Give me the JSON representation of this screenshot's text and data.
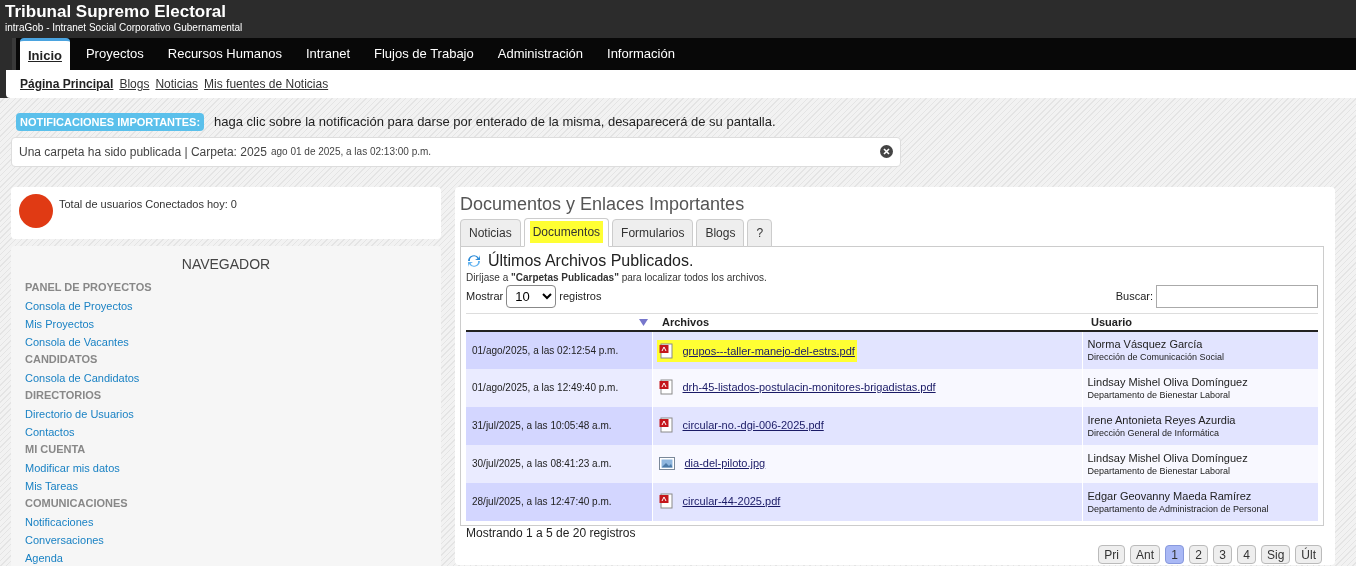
{
  "header": {
    "title": "Tribunal Supremo Electoral",
    "subtitle": "intraGob - Intranet Social Corporativo Gubernamental"
  },
  "nav": [
    {
      "label": "Inicio",
      "selected": true
    },
    {
      "label": "Proyectos",
      "selected": false
    },
    {
      "label": "Recursos Humanos",
      "selected": false
    },
    {
      "label": "Intranet",
      "selected": false
    },
    {
      "label": "Flujos de Trabajo",
      "selected": false
    },
    {
      "label": "Administración",
      "selected": false
    },
    {
      "label": "Información",
      "selected": false
    }
  ],
  "subnav": [
    {
      "label": "Página Principal",
      "selected": true
    },
    {
      "label": "Blogs",
      "selected": false
    },
    {
      "label": "Noticias",
      "selected": false
    },
    {
      "label": "Mis fuentes de Noticias",
      "selected": false
    }
  ],
  "notifications": {
    "badge": "NOTIFICACIONES IMPORTANTES:",
    "hint": "haga clic sobre la notificación para darse por enterado de la misma, desaparecerá de su pantalla.",
    "items": [
      {
        "text": "Una carpeta ha sido publicada | Carpeta: 2025",
        "time": "ago 01 de 2025, a las 02:13:00 p.m."
      }
    ]
  },
  "online": {
    "text": "Total de usuarios Conectados hoy: 0"
  },
  "navigator": {
    "title": "NAVEGADOR",
    "items": [
      {
        "kind": "heading",
        "label": "PANEL DE PROYECTOS"
      },
      {
        "kind": "link",
        "label": "Consola de Proyectos"
      },
      {
        "kind": "link",
        "label": "Mis Proyectos"
      },
      {
        "kind": "link",
        "label": "Consola de Vacantes"
      },
      {
        "kind": "heading",
        "label": "CANDIDATOS"
      },
      {
        "kind": "link",
        "label": "Consola de Candidatos"
      },
      {
        "kind": "heading",
        "label": "DIRECTORIOS"
      },
      {
        "kind": "link",
        "label": "Directorio de Usuarios"
      },
      {
        "kind": "link",
        "label": "Contactos"
      },
      {
        "kind": "heading",
        "label": "MI CUENTA"
      },
      {
        "kind": "link",
        "label": "Modificar mis datos"
      },
      {
        "kind": "link",
        "label": "Mis Tareas"
      },
      {
        "kind": "heading",
        "label": "COMUNICACIONES"
      },
      {
        "kind": "link",
        "label": "Notificaciones"
      },
      {
        "kind": "link",
        "label": "Conversaciones"
      },
      {
        "kind": "link",
        "label": "Agenda"
      }
    ]
  },
  "documents": {
    "title": "Documentos y Enlaces Importantes",
    "tabs": [
      {
        "label": "Noticias",
        "selected": false,
        "highlighted": false
      },
      {
        "label": "Documentos",
        "selected": true,
        "highlighted": true
      },
      {
        "label": "Formularios",
        "selected": false,
        "highlighted": false
      },
      {
        "label": "Blogs",
        "selected": false,
        "highlighted": false
      },
      {
        "label": "?",
        "selected": false,
        "highlighted": false
      }
    ],
    "heading": "Últimos Archivos Publicados.",
    "note": "Diríjase a **\"Carpetas Publicadas\"** para localizar todos los archivos.",
    "show_label": "Mostrar",
    "page_size": "10",
    "show_suffix": "registros",
    "search_label": "Buscar:",
    "columns": [
      "Archivos",
      "Usuario"
    ],
    "rows": [
      {
        "date": "01/ago/2025, a las 02:12:54 p.m.",
        "kind": "pdf",
        "file": "grupos---taller-manejo-del-estrs.pdf",
        "highlighted": true,
        "user": "Norma Vásquez García",
        "dept": "Dirección de Comunicación Social"
      },
      {
        "date": "01/ago/2025, a las 12:49:40 p.m.",
        "kind": "pdf",
        "file": "drh-45-listados-postulacin-monitores-brigadistas.pdf",
        "highlighted": false,
        "user": "Lindsay Mishel Oliva Domínguez",
        "dept": "Departamento de Bienestar Laboral"
      },
      {
        "date": "31/jul/2025, a las 10:05:48 a.m.",
        "kind": "pdf",
        "file": "circular-no.-dgi-006-2025.pdf",
        "highlighted": false,
        "user": "Irene Antonieta Reyes Azurdia",
        "dept": "Dirección General de Informática"
      },
      {
        "date": "30/jul/2025, a las 08:41:23 a.m.",
        "kind": "image",
        "file": "dia-del-piloto.jpg",
        "highlighted": false,
        "user": "Lindsay Mishel Oliva Domínguez",
        "dept": "Departamento de Bienestar Laboral"
      },
      {
        "date": "28/jul/2025, a las 12:47:40 p.m.",
        "kind": "pdf",
        "file": "circular-44-2025.pdf",
        "highlighted": false,
        "user": "Edgar Geovanny Maeda Ramírez",
        "dept": "Departamento de Administracion de Personal"
      }
    ],
    "info": "Mostrando 1 a 5 de 20 registros",
    "pages": [
      {
        "label": "Pri",
        "selected": false
      },
      {
        "label": "Ant",
        "selected": false
      },
      {
        "label": "1",
        "selected": true
      },
      {
        "label": "2",
        "selected": false
      },
      {
        "label": "3",
        "selected": false
      },
      {
        "label": "4",
        "selected": false
      },
      {
        "label": "Sig",
        "selected": false
      },
      {
        "label": "Últ",
        "selected": false
      }
    ]
  }
}
